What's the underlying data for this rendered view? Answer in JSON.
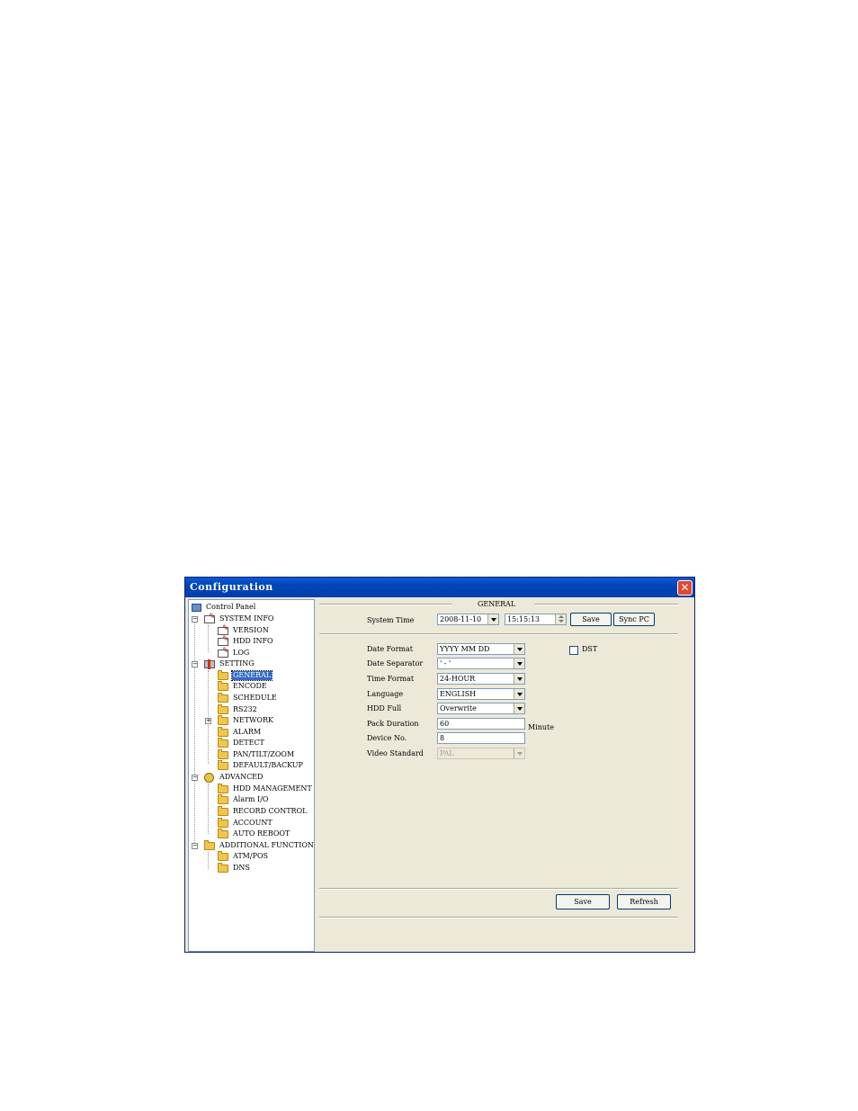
{
  "window": {
    "title": "Configuration"
  },
  "tree": {
    "root": "Control Panel",
    "items": [
      {
        "label": "SYSTEM INFO"
      },
      {
        "label": "VERSION"
      },
      {
        "label": "HDD INFO"
      },
      {
        "label": "LOG"
      },
      {
        "label": "SETTING"
      },
      {
        "label": "GENERAL"
      },
      {
        "label": "ENCODE"
      },
      {
        "label": "SCHEDULE"
      },
      {
        "label": "RS232"
      },
      {
        "label": "NETWORK"
      },
      {
        "label": "ALARM"
      },
      {
        "label": "DETECT"
      },
      {
        "label": "PAN/TILT/ZOOM"
      },
      {
        "label": "DEFAULT/BACKUP"
      },
      {
        "label": "ADVANCED"
      },
      {
        "label": "HDD MANAGEMENT"
      },
      {
        "label": "Alarm I/O"
      },
      {
        "label": "RECORD CONTROL"
      },
      {
        "label": "ACCOUNT"
      },
      {
        "label": "AUTO REBOOT"
      },
      {
        "label": "ADDITIONAL FUNCTION"
      },
      {
        "label": "ATM/POS"
      },
      {
        "label": "DNS"
      }
    ],
    "selected": "GENERAL"
  },
  "general": {
    "section_title": "GENERAL",
    "system_time_label": "System Time",
    "date_value": "2008-11-10",
    "time_value": "15:15:13",
    "save_label": "Save",
    "sync_pc_label": "Sync PC",
    "fields": [
      {
        "label": "Date Format",
        "value": "YYYY MM DD"
      },
      {
        "label": "Date Separator",
        "value": "' - '"
      },
      {
        "label": "Time Format",
        "value": "24-HOUR"
      },
      {
        "label": "Language",
        "value": "ENGLISH"
      },
      {
        "label": "HDD Full",
        "value": "Overwrite"
      },
      {
        "label": "Pack Duration",
        "value": "60"
      },
      {
        "label": "Device No.",
        "value": "8"
      },
      {
        "label": "Video Standard",
        "value": "PAL"
      }
    ],
    "pack_duration_unit": "Minute",
    "dst_label": "DST",
    "dst_checked": false
  },
  "footer": {
    "save_label": "Save",
    "refresh_label": "Refresh"
  }
}
